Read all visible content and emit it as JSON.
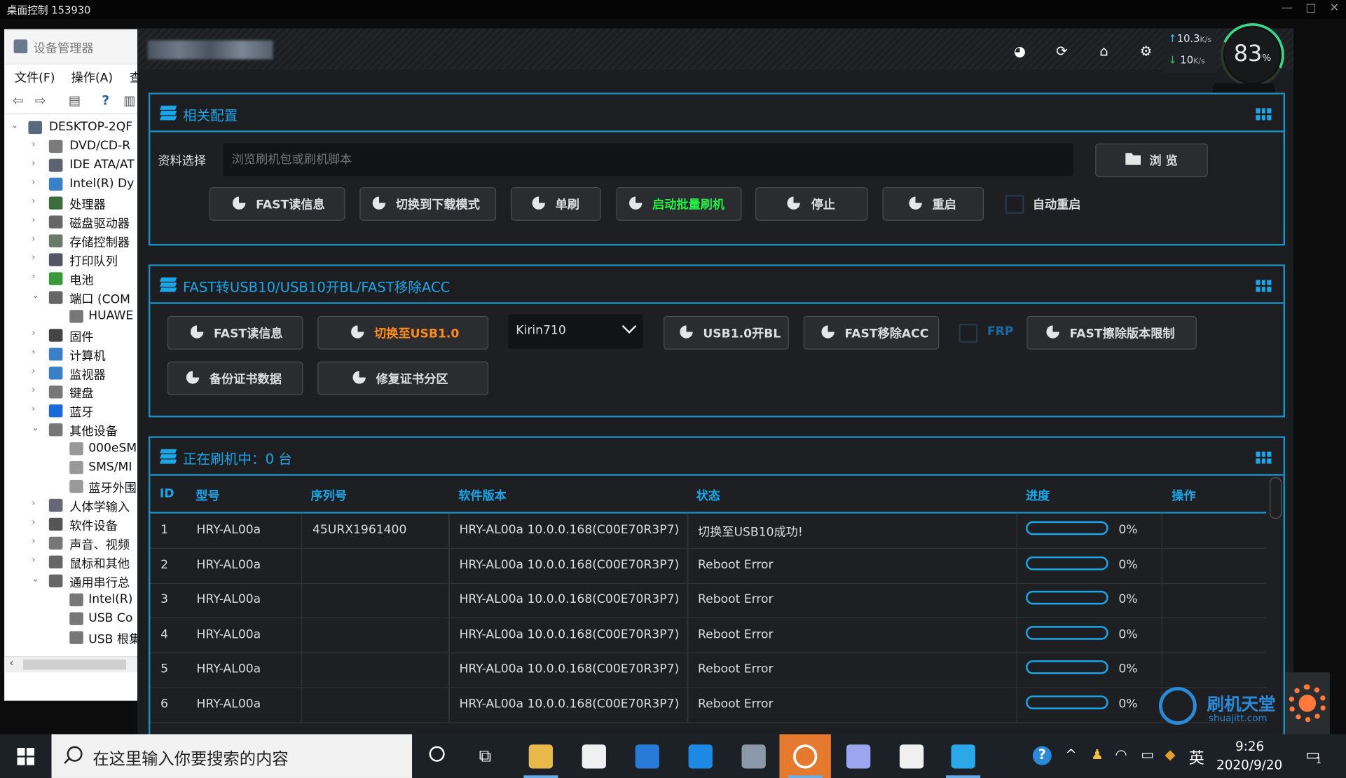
{
  "remote": {
    "title": "桌面控制 153930"
  },
  "devmgr": {
    "title": "设备管理器",
    "menu": [
      "文件(F)",
      "操作(A)",
      "查"
    ],
    "tree": [
      {
        "label": "DESKTOP-2QF",
        "level": 0,
        "exp": "open",
        "color": "#5a6a7e"
      },
      {
        "label": "DVD/CD-R",
        "level": 1,
        "exp": "closed",
        "color": "#7a7a7a"
      },
      {
        "label": "IDE ATA/AT",
        "level": 1,
        "exp": "closed",
        "color": "#5b6470"
      },
      {
        "label": "Intel(R) Dy",
        "level": 1,
        "exp": "closed",
        "color": "#3a80c8"
      },
      {
        "label": "处理器",
        "level": 1,
        "exp": "closed",
        "color": "#3c6e3c"
      },
      {
        "label": "磁盘驱动器",
        "level": 1,
        "exp": "closed",
        "color": "#666"
      },
      {
        "label": "存储控制器",
        "level": 1,
        "exp": "closed",
        "color": "#6a7a6a"
      },
      {
        "label": "打印队列",
        "level": 1,
        "exp": "closed",
        "color": "#556"
      },
      {
        "label": "电池",
        "level": 1,
        "exp": "closed",
        "color": "#3a9a3a"
      },
      {
        "label": "端口 (COM",
        "level": 1,
        "exp": "open",
        "color": "#666"
      },
      {
        "label": "HUAWE",
        "level": 2,
        "exp": "",
        "color": "#777"
      },
      {
        "label": "固件",
        "level": 1,
        "exp": "closed",
        "color": "#444"
      },
      {
        "label": "计算机",
        "level": 1,
        "exp": "closed",
        "color": "#3a80c8"
      },
      {
        "label": "监视器",
        "level": 1,
        "exp": "closed",
        "color": "#3a80c8"
      },
      {
        "label": "键盘",
        "level": 1,
        "exp": "closed",
        "color": "#777"
      },
      {
        "label": "蓝牙",
        "level": 1,
        "exp": "closed",
        "color": "#1a6ad8"
      },
      {
        "label": "其他设备",
        "level": 1,
        "exp": "open",
        "color": "#777"
      },
      {
        "label": "000eSM",
        "level": 2,
        "exp": "",
        "color": "#999"
      },
      {
        "label": "SMS/MI",
        "level": 2,
        "exp": "",
        "color": "#999"
      },
      {
        "label": "蓝牙外围",
        "level": 2,
        "exp": "",
        "color": "#999"
      },
      {
        "label": "人体学输入",
        "level": 1,
        "exp": "closed",
        "color": "#667"
      },
      {
        "label": "软件设备",
        "level": 1,
        "exp": "closed",
        "color": "#555"
      },
      {
        "label": "声音、视频",
        "level": 1,
        "exp": "closed",
        "color": "#777"
      },
      {
        "label": "鼠标和其他",
        "level": 1,
        "exp": "closed",
        "color": "#666"
      },
      {
        "label": "通用串行总",
        "level": 1,
        "exp": "open",
        "color": "#666"
      },
      {
        "label": "Intel(R)",
        "level": 2,
        "exp": "",
        "color": "#777"
      },
      {
        "label": "USB Co",
        "level": 2,
        "exp": "",
        "color": "#777"
      },
      {
        "label": "USB 根集",
        "level": 2,
        "exp": "",
        "color": "#777"
      }
    ]
  },
  "speed": {
    "up": "10.3",
    "down": "10",
    "unit": "K/s"
  },
  "gauge": {
    "value": "83",
    "unit": "%"
  },
  "back": {
    "label": "返回"
  },
  "section1": {
    "title": "相关配置",
    "file_label": "资料选择",
    "file_placeholder": "浏览刷机包或刷机脚本",
    "browse": "浏 览",
    "buttons": [
      "FAST读信息",
      "切换到下载模式",
      "单刷",
      "启动批量刷机",
      "停止",
      "重启"
    ],
    "auto_reboot": "自动重启"
  },
  "section2": {
    "title": "FAST转USB10/USB10开BL/FAST移除ACC",
    "buttons": [
      "FAST读信息",
      "切换至USB1.0",
      "USB1.0开BL",
      "FAST移除ACC",
      "FAST擦除版本限制",
      "备份证书数据",
      "修复证书分区"
    ],
    "chip": "Kirin710",
    "frp": "FRP"
  },
  "section3": {
    "title": "正在刷机中：0 台",
    "columns": [
      "ID",
      "型号",
      "序列号",
      "软件版本",
      "状态",
      "进度",
      "操作"
    ],
    "rows": [
      {
        "id": "1",
        "model": "HRY-AL00a",
        "serial": "45URX1961400",
        "version": "HRY-AL00a 10.0.0.168(C00E70R3P7)",
        "status": "切换至USB10成功!",
        "progress": 0,
        "pct": "0%"
      },
      {
        "id": "2",
        "model": "HRY-AL00a",
        "serial": "",
        "version": "HRY-AL00a 10.0.0.168(C00E70R3P7)",
        "status": "Reboot Error",
        "progress": 0,
        "pct": "0%"
      },
      {
        "id": "3",
        "model": "HRY-AL00a",
        "serial": "",
        "version": "HRY-AL00a 10.0.0.168(C00E70R3P7)",
        "status": "Reboot Error",
        "progress": 0,
        "pct": "0%"
      },
      {
        "id": "4",
        "model": "HRY-AL00a",
        "serial": "",
        "version": "HRY-AL00a 10.0.0.168(C00E70R3P7)",
        "status": "Reboot Error",
        "progress": 0,
        "pct": "0%"
      },
      {
        "id": "5",
        "model": "HRY-AL00a",
        "serial": "",
        "version": "HRY-AL00a 10.0.0.168(C00E70R3P7)",
        "status": "Reboot Error",
        "progress": 0,
        "pct": "0%"
      },
      {
        "id": "6",
        "model": "HRY-AL00a",
        "serial": "",
        "version": "HRY-AL00a 10.0.0.168(C00E70R3P7)",
        "status": "Reboot Error",
        "progress": 0,
        "pct": "0%"
      }
    ]
  },
  "watermark": {
    "name": "刷机天堂",
    "url": "shuajitt.com"
  },
  "taskbar": {
    "search_placeholder": "在这里输入你要搜索的内容",
    "apps": [
      {
        "name": "file-explorer",
        "color": "#e8b84a",
        "active": false
      },
      {
        "name": "store",
        "color": "#f0f0f0",
        "active": false
      },
      {
        "name": "k-app",
        "color": "#2a7ad8",
        "active": false
      },
      {
        "name": "edge",
        "color": "#1e88e5",
        "active": false
      },
      {
        "name": "device-manager",
        "color": "#8a98a8",
        "active": false
      },
      {
        "name": "sync-tool",
        "color": "#ffffff",
        "active": true
      },
      {
        "name": "network-tool",
        "color": "#9aa6ee",
        "active": false
      },
      {
        "name": "security",
        "color": "#f0f0f0",
        "active": false
      },
      {
        "name": "v-app",
        "color": "#2aa8e8",
        "active": false
      }
    ],
    "ime": "英",
    "time": "9:26",
    "date": "2020/9/20",
    "notifications": "1"
  }
}
